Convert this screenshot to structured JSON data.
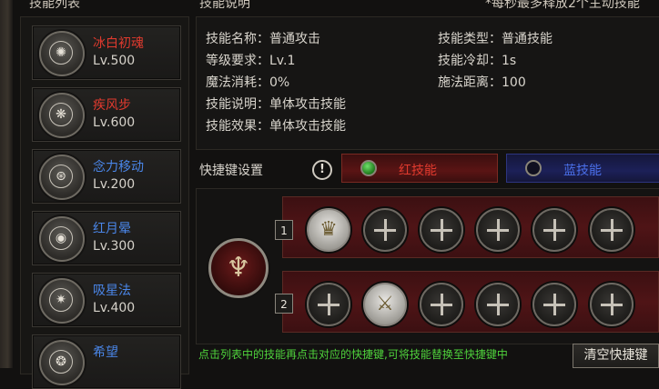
{
  "headers": {
    "skill_list": "技能列表",
    "skill_desc": "技能说明",
    "note": "*每秒最多释放2个主动技能"
  },
  "skills": [
    {
      "name": "冰白初魂",
      "level": "Lv.500",
      "name_color": "#e03a2e",
      "icon": "ice-soul-icon",
      "glyph": "✺"
    },
    {
      "name": "疾风步",
      "level": "Lv.600",
      "name_color": "#e03a2e",
      "icon": "wind-step-icon",
      "glyph": "❋"
    },
    {
      "name": "念力移动",
      "level": "Lv.200",
      "name_color": "#4a86e8",
      "icon": "teleport-icon",
      "glyph": "⊛"
    },
    {
      "name": "红月晕",
      "level": "Lv.300",
      "name_color": "#4a86e8",
      "icon": "eye-icon",
      "glyph": "◉"
    },
    {
      "name": "吸星法",
      "level": "Lv.400",
      "name_color": "#4a86e8",
      "icon": "star-absorb-icon",
      "glyph": "✷"
    },
    {
      "name": "希望",
      "level": "",
      "name_color": "#4a86e8",
      "icon": "hope-icon",
      "glyph": "❂"
    }
  ],
  "desc": {
    "name_label": "技能名称：",
    "name_value": "普通攻击",
    "req_label": "等级要求：",
    "req_value": "Lv.1",
    "mana_label": "魔法消耗：",
    "mana_value": "0%",
    "explain_label": "技能说明：",
    "explain_value": "单体攻击技能",
    "effect_label": "技能效果：",
    "effect_value": "单体攻击技能",
    "type_label": "技能类型：",
    "type_value": "普通技能",
    "cd_label": "技能冷却：",
    "cd_value": "1s",
    "range_label": "施法距离：",
    "range_value": "100"
  },
  "hotkey": {
    "label": "快捷键设置",
    "warn_symbol": "!",
    "red_tab": "红技能",
    "blue_tab": "蓝技能",
    "row1_num": "1",
    "row2_num": "2"
  },
  "tip": "点击列表中的技能再点击对应的快捷键,可将技能替换至快捷键中",
  "clear_button": "清空快捷键",
  "colors": {
    "red_accent": "#e03a2e",
    "blue_accent": "#4a86e8",
    "tip_green": "#4fd23c"
  }
}
